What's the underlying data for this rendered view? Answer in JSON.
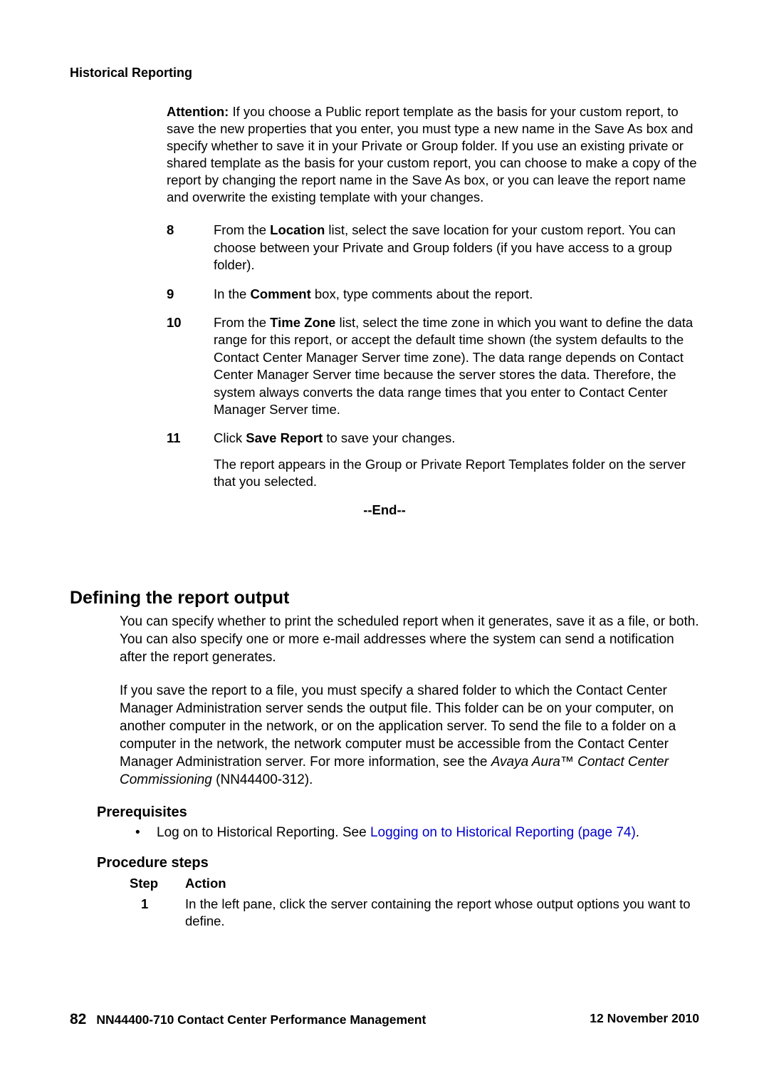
{
  "header": {
    "running_title": "Historical Reporting"
  },
  "attention": {
    "label": "Attention:",
    "text": "  If you choose a Public report template as the basis for your custom report, to save the new properties that you enter, you must type a new name in the Save As box and specify whether to save it in your Private or Group folder. If you use an existing private or shared template as the basis for your custom report, you can choose to make a copy of the report by changing the report name in the Save As box, or you can leave the report name and overwrite the existing template with your changes."
  },
  "steps": [
    {
      "num": "8",
      "pre": "From the ",
      "bold": "Location",
      "post": " list, select the save location for your custom report. You can choose between your Private and Group folders (if you have access to a group folder)."
    },
    {
      "num": "9",
      "pre": "In the ",
      "bold": "Comment",
      "post": " box, type comments about the report."
    },
    {
      "num": "10",
      "pre": "From the ",
      "bold": "Time Zone",
      "post": " list, select the time zone in which you want to define the data range for this report, or accept the default time shown (the system defaults to the Contact Center Manager Server time zone). The data range depends on Contact Center Manager Server time because the server stores the data. Therefore, the system always converts the data range times that you enter to Contact Center Manager Server time."
    },
    {
      "num": "11",
      "pre": "Click ",
      "bold": "Save Report",
      "post": " to save your changes.",
      "after": "The report appears in the Group or Private Report Templates folder on the server that you selected."
    }
  ],
  "end_marker": "--End--",
  "section": {
    "heading": "Defining the report output",
    "para1": "You can specify whether to print the scheduled report when it generates, save it as a file, or both. You can also specify one or more e-mail addresses where the system can send a notification after the report generates.",
    "para2_a": "If you save the report to a file, you must specify a shared folder to which the Contact Center Manager Administration server sends the output file. This folder can be on your computer, on another computer in the network, or on the application server. To send the file to a folder on a computer in the network, the network computer must be accessible from the Contact Center Manager Administration server. For more information, see the ",
    "para2_italic": "Avaya Aura™ Contact Center Commissioning",
    "para2_b": " (NN44400-312)."
  },
  "prereq": {
    "heading": "Prerequisites",
    "bullet_pre": "Log on to Historical Reporting. See ",
    "bullet_link": "Logging on to Historical Reporting (page 74)",
    "bullet_post": "."
  },
  "procedure": {
    "heading": "Procedure steps",
    "col1": "Step",
    "col2": "Action",
    "step1_num": "1",
    "step1_text": "In the left pane, click the server containing the report whose output options you want to define."
  },
  "footer": {
    "page_number": "82",
    "doc_title": "NN44400-710 Contact Center Performance Management",
    "date": "12 November 2010"
  }
}
